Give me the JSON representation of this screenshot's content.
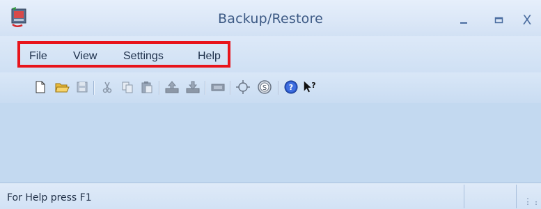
{
  "window": {
    "title": "Backup/Restore",
    "controls": {
      "minimize": "_",
      "maximize": "□",
      "close": "X"
    }
  },
  "menu": {
    "items": [
      "File",
      "View",
      "Settings",
      "Help"
    ],
    "highlight_color": "#e8141b"
  },
  "toolbar": {
    "buttons": [
      {
        "name": "new-icon",
        "enabled": true
      },
      {
        "name": "open-folder-icon",
        "enabled": true
      },
      {
        "name": "save-icon",
        "enabled": false
      },
      {
        "name": "cut-icon",
        "enabled": false
      },
      {
        "name": "copy-icon",
        "enabled": false
      },
      {
        "name": "paste-icon",
        "enabled": false
      },
      {
        "name": "upload-icon",
        "enabled": false
      },
      {
        "name": "download-icon",
        "enabled": false
      },
      {
        "name": "tape-icon",
        "enabled": false
      },
      {
        "name": "target-icon",
        "enabled": true
      },
      {
        "name": "s-circle-icon",
        "enabled": true
      },
      {
        "name": "help-circle-icon",
        "enabled": true
      },
      {
        "name": "context-help-icon",
        "enabled": true
      }
    ]
  },
  "status": {
    "text": "For Help press F1"
  },
  "colors": {
    "window_bg": "#c5daf1",
    "title_text": "#3d5a85"
  }
}
